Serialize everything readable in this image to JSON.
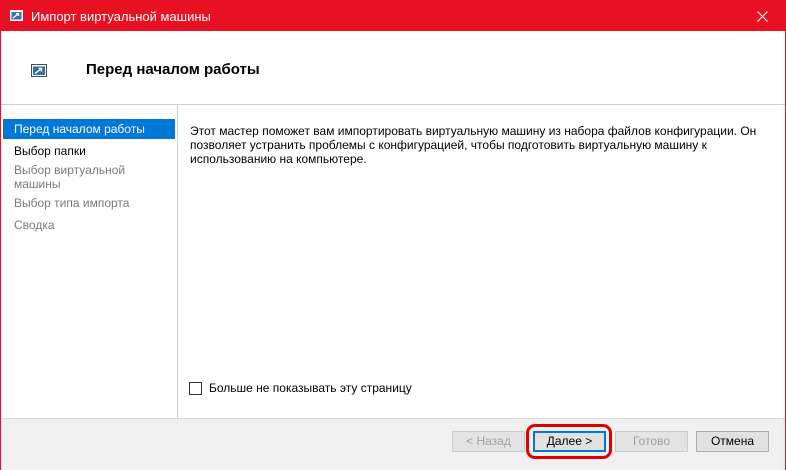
{
  "window": {
    "title": "Импорт виртуальной машины",
    "title_icon": "import-vm-icon",
    "close_icon": "close-icon",
    "accent_color": "#e81123"
  },
  "header": {
    "title": "Перед началом работы",
    "icon": "import-vm-icon"
  },
  "sidebar": {
    "items": [
      {
        "label": "Перед началом работы",
        "state": "active"
      },
      {
        "label": "Выбор папки",
        "state": "enabled"
      },
      {
        "label": "Выбор виртуальной машины",
        "state": "disabled"
      },
      {
        "label": "Выбор типа импорта",
        "state": "disabled"
      },
      {
        "label": "Сводка",
        "state": "disabled"
      }
    ],
    "active_color": "#0078d7"
  },
  "content": {
    "description": "Этот мастер поможет вам импортировать виртуальную машину из набора файлов конфигурации. Он позволяет устранить проблемы с конфигурацией, чтобы подготовить виртуальную машину к использованию на компьютере.",
    "checkbox_label": "Больше не показывать эту страницу",
    "checkbox_checked": false
  },
  "footer": {
    "back_label": "< Назад",
    "next_label": "Далее >",
    "finish_label": "Готово",
    "cancel_label": "Отмена",
    "highlight_color": "#e10000"
  }
}
